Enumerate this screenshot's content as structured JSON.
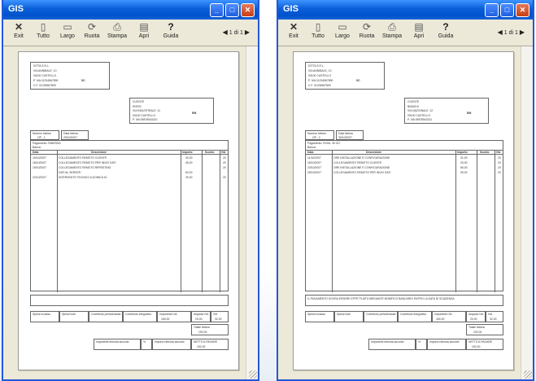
{
  "windows": [
    {
      "title": "GIS",
      "toolbar": [
        {
          "label": "Exit",
          "icon": "close-icon"
        },
        {
          "label": "Tutto",
          "icon": "fit-page-icon"
        },
        {
          "label": "Largo",
          "icon": "fit-width-icon"
        },
        {
          "label": "Ruota",
          "icon": "rotate-icon"
        },
        {
          "label": "Stampa",
          "icon": "print-icon"
        },
        {
          "label": "Apri",
          "icon": "open-icon"
        },
        {
          "label": "Guida",
          "icon": "help-icon"
        }
      ],
      "page_indicator": "1 di 1",
      "doc": {
        "sender": [
          "DITTA S.R.L.",
          "VIA ANNIBALE, 10",
          "00100 CASTELLO",
          "P. IVA 01234567890",
          "C.F. 01234567890"
        ],
        "sender_code": "SC",
        "recipient": [
          "CLIENTE",
          "ROSSI",
          "VIA INDUSTRIALE, 11",
          "00100 CASTELLO",
          "P. IVA 09876543210"
        ],
        "recipient_code": "RM",
        "meta_head": [
          "Numero fattura",
          "Data fattura"
        ],
        "meta_vals": [
          "OP - 1",
          "29/10/2007"
        ],
        "pay_line": "Pagamento: RIMESSA",
        "note_line": "Banca:",
        "col_heads": [
          "Data",
          "Descrizione",
          "Importo",
          "Sconto",
          "IVA"
        ],
        "rows": [
          {
            "date": "15/10/2007",
            "desc": "COLLEGAMENTO REMOTO CLIENTE",
            "amount": "30,00",
            "iva": "20"
          },
          {
            "date": "18/10/2007",
            "desc": "COLLEGAMENTO REMOTO PER INVIO DATI",
            "amount": "45,00",
            "iva": "20"
          },
          {
            "date": "19/10/2007",
            "desc": "COLLEGAMENTO REMOTO RIPRISTINO",
            "amount": "",
            "iva": "20"
          },
          {
            "date": "",
            "desc": "DATI AL SERVER",
            "amount": "60,00",
            "iva": ""
          },
          {
            "date": "22/10/2007",
            "desc": "INTERVENTO TECNICO A DOMICILIO",
            "amount": "25,00",
            "iva": "20"
          }
        ],
        "summary_heads": [
          "Spese incasso",
          "Spese bolli",
          "Contributo previdenziale",
          "Contributo integrativo",
          "Imponibile IVA",
          "Aliquota IVA",
          "IVA"
        ],
        "summary_vals": [
          "",
          "",
          "",
          "",
          "160,00",
          "20,00",
          "32,00"
        ],
        "total_label": "Totale fattura",
        "total_val": "192,00",
        "footer_heads": [
          "Imponibile ritenuta acconto",
          "%",
          "Importo ritenuta acconto",
          "NETTO A PAGARE"
        ],
        "footer_vals": [
          "",
          "",
          "",
          "192,00"
        ],
        "note_text": ""
      }
    },
    {
      "title": "GIS",
      "toolbar": [
        {
          "label": "Exit",
          "icon": "close-icon"
        },
        {
          "label": "Tutto",
          "icon": "fit-page-icon"
        },
        {
          "label": "Largo",
          "icon": "fit-width-icon"
        },
        {
          "label": "Ruota",
          "icon": "rotate-icon"
        },
        {
          "label": "Stampa",
          "icon": "print-icon"
        },
        {
          "label": "Apri",
          "icon": "open-icon"
        },
        {
          "label": "Guida",
          "icon": "help-icon"
        }
      ],
      "page_indicator": "1 di 1",
      "doc": {
        "sender": [
          "DITTA S.R.L.",
          "VIA ANNIBALE, 10",
          "00100 CASTELLO",
          "P. IVA 01234567890",
          "C.F. 01234567890"
        ],
        "sender_code": "SC",
        "recipient": [
          "CLIENTE",
          "BIANCHI",
          "VIA NAZIONALE, 12",
          "00100 CASTELLO",
          "P. IVA 09876543211"
        ],
        "recipient_code": "RM",
        "meta_head": [
          "Numero fattura",
          "Data fattura"
        ],
        "meta_vals": [
          "OP - 2",
          "30/10/2007"
        ],
        "pay_line": "Pagamento: RI.BA. 30 GG",
        "note_line": "Banca:",
        "col_heads": [
          "Data",
          "Descrizione",
          "Importo",
          "Sconto",
          "IVA"
        ],
        "rows": [
          {
            "date": "11/10/2007",
            "desc": "ORE INSTALLAZIONE E CONFIGURAZIONE",
            "amount": "31,00",
            "iva": "20"
          },
          {
            "date": "16/10/2007",
            "desc": "COLLEGAMENTO REMOTO CLIENTE",
            "amount": "25,00",
            "iva": "20"
          },
          {
            "date": "23/10/2007",
            "desc": "ORE INSTALLAZIONE E CONFIGURAZIONE",
            "amount": "65,00",
            "iva": "20"
          },
          {
            "date": "25/10/2007",
            "desc": "COLLEGAMENTO REMOTO PER INVIO DATI",
            "amount": "39,00",
            "iva": "20"
          }
        ],
        "summary_heads": [
          "Spese incasso",
          "Spese bolli",
          "Contributo previdenziale",
          "Contributo integrativo",
          "Imponibile IVA",
          "Aliquota IVA",
          "IVA"
        ],
        "summary_vals": [
          "",
          "",
          "",
          "",
          "160,00",
          "20,00",
          "32,00"
        ],
        "total_label": "Totale fattura",
        "total_val": "192,00",
        "footer_heads": [
          "Imponibile ritenuta acconto",
          "%",
          "Importo ritenuta acconto",
          "NETTO A PAGARE"
        ],
        "footer_vals": [
          "",
          "",
          "",
          "192,00"
        ],
        "note_text": "IL PAGAMENTO DOVRA ESSERE EFFETTUATO MEDIANTE BONIFICO BANCARIO ENTRO LA DATA DI SCADENZA."
      }
    }
  ]
}
